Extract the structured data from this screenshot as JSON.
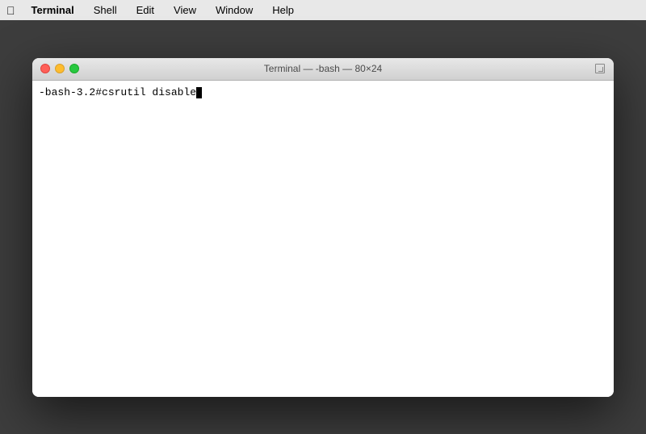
{
  "menubar": {
    "apple": "&#63743;",
    "items": [
      {
        "label": "Terminal",
        "active": true
      },
      {
        "label": "Shell"
      },
      {
        "label": "Edit"
      },
      {
        "label": "View"
      },
      {
        "label": "Window"
      },
      {
        "label": "Help"
      }
    ]
  },
  "window": {
    "title": "Terminal — -bash — 80×24",
    "prompt": "-bash-3.2#",
    "command": " csrutil disable"
  },
  "colors": {
    "close": "#ff5f57",
    "minimize": "#febc2e",
    "maximize": "#28c840",
    "desktop_bg": "#3d3d3d",
    "menubar_bg": "#e8e8e8"
  }
}
